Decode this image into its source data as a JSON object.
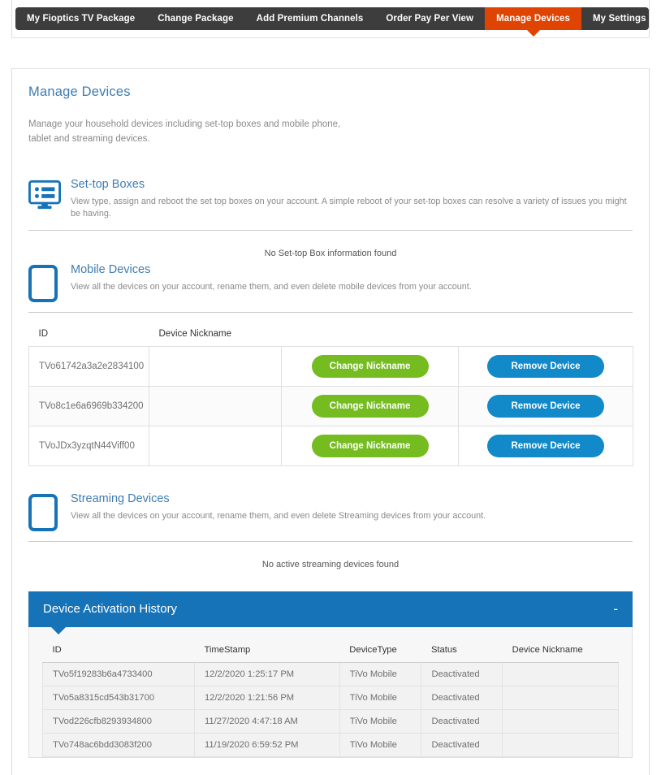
{
  "nav": {
    "items": [
      {
        "label": "My Fioptics TV Package",
        "active": false
      },
      {
        "label": "Change Package",
        "active": false
      },
      {
        "label": "Add Premium Channels",
        "active": false
      },
      {
        "label": "Order Pay Per View",
        "active": false
      },
      {
        "label": "Manage Devices",
        "active": true
      },
      {
        "label": "My Settings",
        "active": false
      }
    ],
    "active_color": "#e04403",
    "bar_color": "#3d3d3d"
  },
  "page": {
    "title": "Manage Devices",
    "description": "Manage your household devices including set-top boxes and mobile phone, tablet and streaming devices.",
    "title_color": "#3e7cb1"
  },
  "settop": {
    "icon": "settop-box-icon",
    "title": "Set-top Boxes",
    "subtitle": "View type, assign and reboot the set top boxes on your account. A simple reboot of your set-top boxes can resolve a variety of issues you might be having.",
    "empty_message": "No Set-top Box information found"
  },
  "mobile": {
    "icon": "mobile-phone-icon",
    "title": "Mobile Devices",
    "subtitle": "View all the devices on your account, rename them, and even delete mobile devices from your account.",
    "columns": [
      "ID",
      "Device Nickname",
      "",
      ""
    ],
    "rows": [
      {
        "id": "TVo61742a3a2e2834100",
        "nickname": "",
        "change_label": "Change Nickname",
        "remove_label": "Remove Device"
      },
      {
        "id": "TVo8c1e6a6969b334200",
        "nickname": "",
        "change_label": "Change Nickname",
        "remove_label": "Remove Device"
      },
      {
        "id": "TVoJDx3yzqtN44Viff00",
        "nickname": "",
        "change_label": "Change Nickname",
        "remove_label": "Remove Device"
      }
    ],
    "button_green": "#74bc1f",
    "button_blue": "#1289c8"
  },
  "streaming": {
    "icon": "mobile-phone-icon",
    "title": "Streaming Devices",
    "subtitle": "View all the devices on your account, rename them, and even delete Streaming devices from your account.",
    "empty_message": "No active streaming devices found"
  },
  "history": {
    "title": "Device Activation History",
    "toggle_symbol": "-",
    "bar_color": "#1773b8",
    "columns": [
      "ID",
      "TimeStamp",
      "DeviceType",
      "Status",
      "Device Nickname"
    ],
    "rows": [
      {
        "id": "TVo5f19283b6a4733400",
        "timestamp": "12/2/2020 1:25:17 PM",
        "device_type": "TiVo Mobile",
        "status": "Deactivated",
        "nickname": ""
      },
      {
        "id": "TVo5a8315cd543b31700",
        "timestamp": "12/2/2020 1:21:56 PM",
        "device_type": "TiVo Mobile",
        "status": "Deactivated",
        "nickname": ""
      },
      {
        "id": "TVod226cfb8293934800",
        "timestamp": "11/27/2020 4:47:18 AM",
        "device_type": "TiVo Mobile",
        "status": "Deactivated",
        "nickname": ""
      },
      {
        "id": "TVo748ac6bdd3083f200",
        "timestamp": "11/19/2020 6:59:52 PM",
        "device_type": "TiVo Mobile",
        "status": "Deactivated",
        "nickname": ""
      }
    ]
  }
}
